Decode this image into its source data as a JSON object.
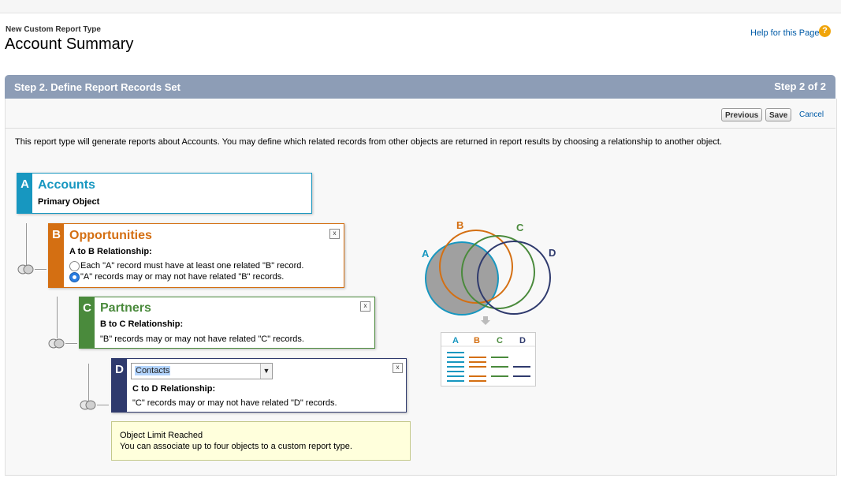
{
  "header": {
    "subtitle": "New Custom Report Type",
    "title": "Account Summary",
    "help_link": "Help for this Page",
    "help_icon": "question-icon"
  },
  "step": {
    "title": "Step 2. Define Report Records Set",
    "count": "Step 2 of 2"
  },
  "toolbar": {
    "previous_label": "Previous",
    "save_label": "Save",
    "cancel_label": "Cancel"
  },
  "intro_text": "This report type will generate reports about Accounts. You may define which related records from other objects are returned in report results by choosing a relationship to another object.",
  "objects": {
    "a": {
      "letter": "A",
      "name": "Accounts",
      "subtitle": "Primary Object",
      "color": "#1797c0"
    },
    "b": {
      "letter": "B",
      "name": "Opportunities",
      "relationship_label": "A to B Relationship:",
      "option1": "Each \"A\" record must have at least one related \"B\" record.",
      "option2": "\"A\" records may or may not have related \"B\" records.",
      "selected_option": 2,
      "color": "#d46f12",
      "close": "x"
    },
    "c": {
      "letter": "C",
      "name": "Partners",
      "relationship_label": "B to C Relationship:",
      "text": "\"B\" records may or may not have related \"C\" records.",
      "color": "#4a8a3c",
      "close": "x"
    },
    "d": {
      "letter": "D",
      "selected_object": "Contacts",
      "relationship_label": "C to D Relationship:",
      "text": "\"C\" records may or may not have related \"D\" records.",
      "color": "#2f3a6d",
      "close": "x"
    }
  },
  "limit_notice": {
    "title": "Object Limit Reached",
    "text": "You can associate up to four objects to a custom report type."
  },
  "venn": {
    "labels": [
      "A",
      "B",
      "C",
      "D"
    ],
    "colors": [
      "#1797c0",
      "#d46f12",
      "#4a8a3c",
      "#2f3a6d"
    ],
    "fill": "#a0a0a0"
  },
  "table_preview": {
    "headers": [
      "A",
      "B",
      "C",
      "D"
    ]
  }
}
